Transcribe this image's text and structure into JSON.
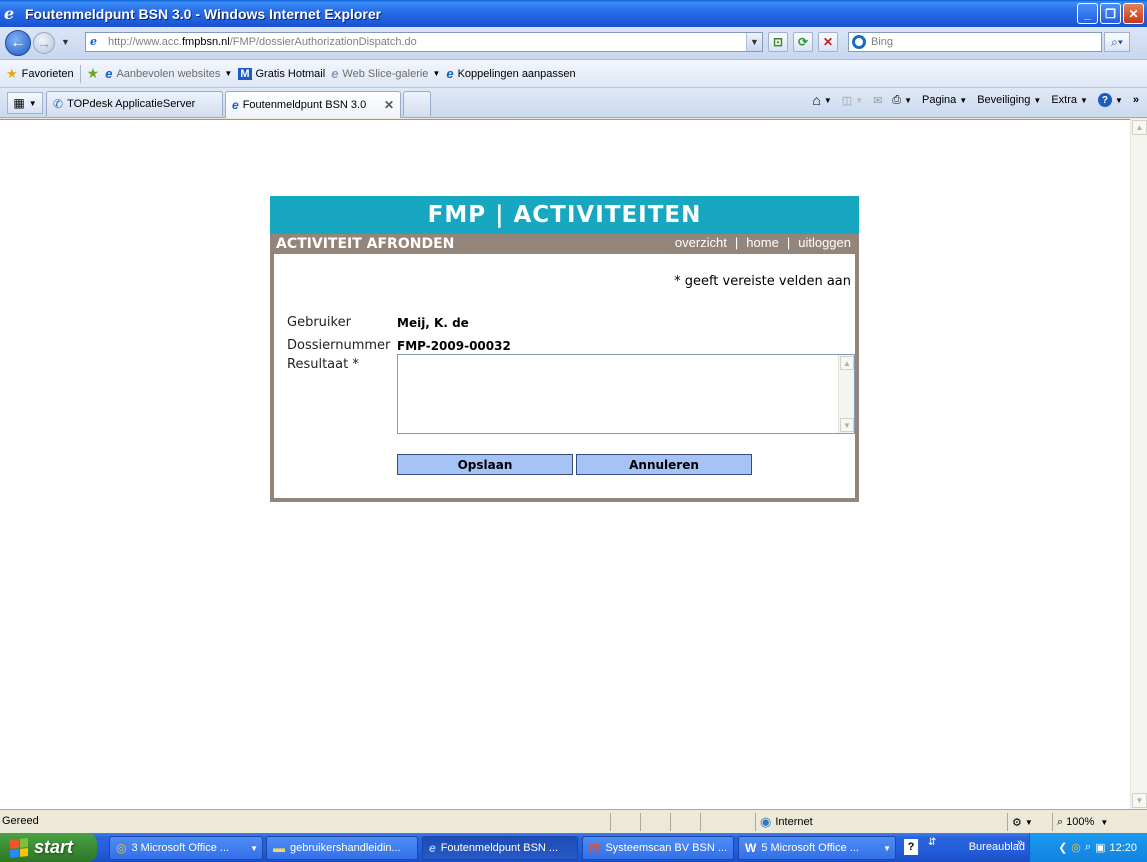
{
  "window": {
    "title": "Foutenmeldpunt BSN 3.0 - Windows Internet Explorer",
    "buttons": {
      "minimize": "_",
      "maximize": "❐",
      "close": "✕"
    }
  },
  "address_bar": {
    "url_prefix": "http://www.acc.",
    "url_host": "fmpbsn.nl",
    "url_path": "/FMP/dossierAuthorizationDispatch.do",
    "search_placeholder": "Bing"
  },
  "favorites_bar": {
    "favorites_label": "Favorieten",
    "items": [
      {
        "label": "Aanbevolen websites",
        "muted": true
      },
      {
        "label": "Gratis Hotmail",
        "muted": false
      },
      {
        "label": "Web Slice-galerie",
        "muted": true
      },
      {
        "label": "Koppelingen aanpassen",
        "muted": false
      }
    ]
  },
  "tabs": [
    {
      "label": "TOPdesk ApplicatieServer",
      "active": false
    },
    {
      "label": "Foutenmeldpunt BSN 3.0",
      "active": true
    }
  ],
  "command_bar": {
    "pagina": "Pagina",
    "beveiliging": "Beveiliging",
    "extra": "Extra"
  },
  "app": {
    "header": "FMP | ACTIVITEITEN",
    "subheader": "ACTIVITEIT AFRONDEN",
    "nav_links": [
      "overzicht",
      "home",
      "uitloggen"
    ],
    "nav_separator": "|",
    "required_note": "* geeft vereiste velden aan",
    "fields": {
      "gebruiker_label": "Gebruiker",
      "gebruiker_value": "Meij, K. de",
      "dossier_label": "Dossiernummer",
      "dossier_value": "FMP-2009-00032",
      "resultaat_label": "Resultaat *",
      "resultaat_value": ""
    },
    "buttons": {
      "save": "Opslaan",
      "cancel": "Annuleren"
    }
  },
  "status_bar": {
    "status": "Gereed",
    "zone": "Internet",
    "zoom": "100%"
  },
  "taskbar": {
    "start": "start",
    "tasks": [
      {
        "label": "3 Microsoft Office ...",
        "active": false
      },
      {
        "label": "gebruikershandleidin...",
        "active": false
      },
      {
        "label": "Foutenmeldpunt BSN ...",
        "active": true
      },
      {
        "label": "Systeemscan BV BSN ...",
        "active": false
      },
      {
        "label": "5 Microsoft Office ...",
        "active": false
      }
    ],
    "desktop_label": "Bureaublad",
    "clock": "12:20"
  }
}
